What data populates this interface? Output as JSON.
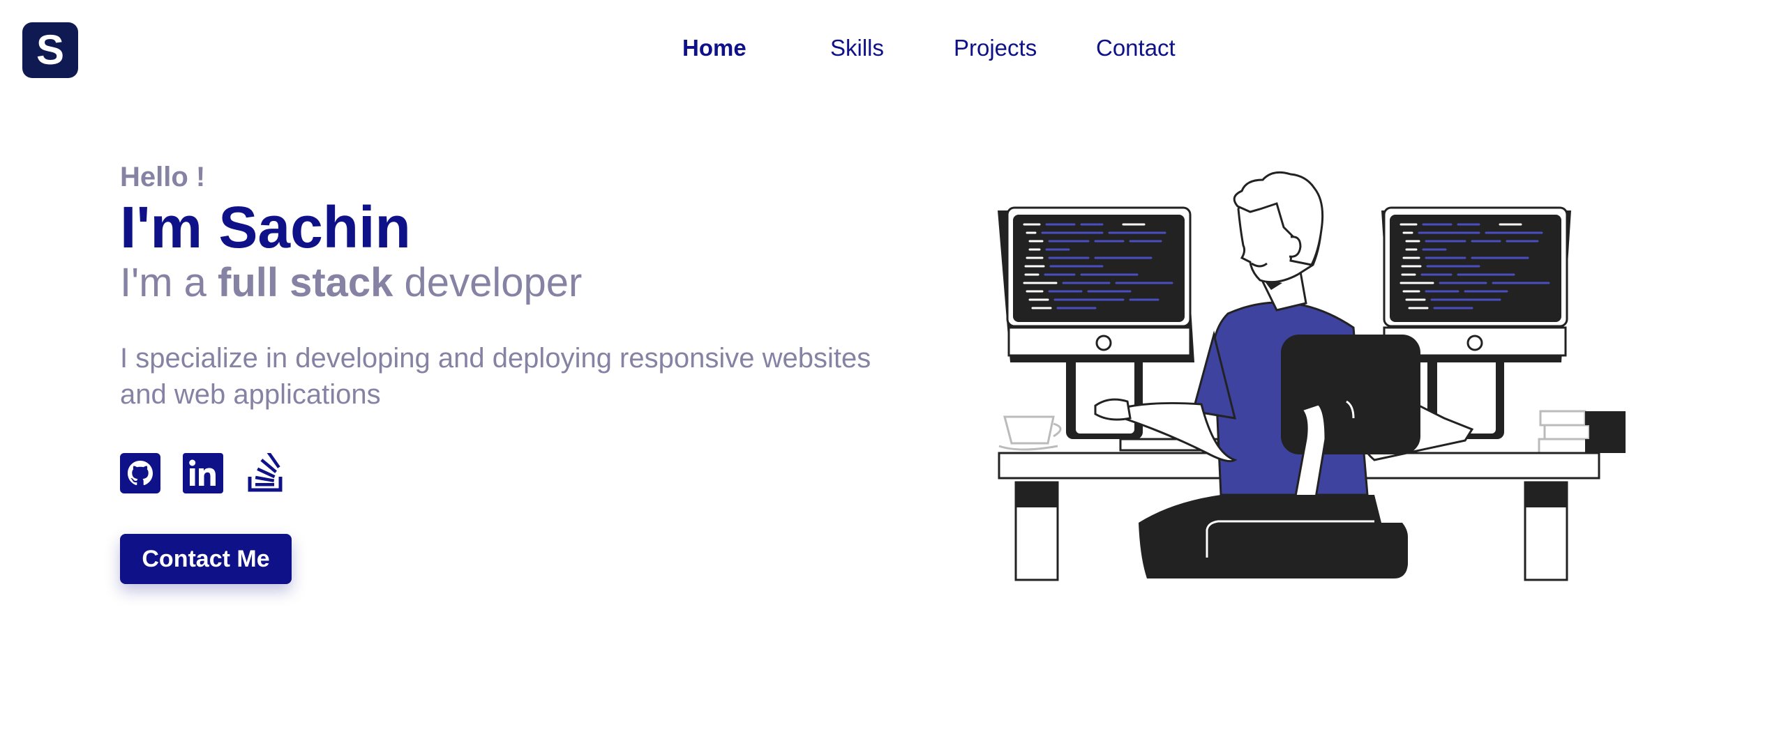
{
  "logo": {
    "letter": "S"
  },
  "nav": {
    "items": [
      {
        "label": "Home",
        "active": true
      },
      {
        "label": "Skills",
        "active": false
      },
      {
        "label": "Projects",
        "active": false
      },
      {
        "label": "Contact",
        "active": false
      }
    ]
  },
  "hero": {
    "greeting": "Hello !",
    "name": "I'm Sachin",
    "role_prefix": "I'm a ",
    "role_highlight": "full stack",
    "role_suffix": " developer",
    "description": "I specialize in developing and deploying responsive websites and web applications"
  },
  "social": [
    {
      "name": "GitHub",
      "icon": "github-icon"
    },
    {
      "name": "LinkedIn",
      "icon": "linkedin-icon"
    },
    {
      "name": "Stack Overflow",
      "icon": "stackoverflow-icon"
    }
  ],
  "cta": {
    "label": "Contact Me"
  },
  "colors": {
    "primary": "#0e1187",
    "logo_bg": "#101a52",
    "muted_text": "#8582a3",
    "shirt": "#3f43a0",
    "dark": "#222222"
  }
}
